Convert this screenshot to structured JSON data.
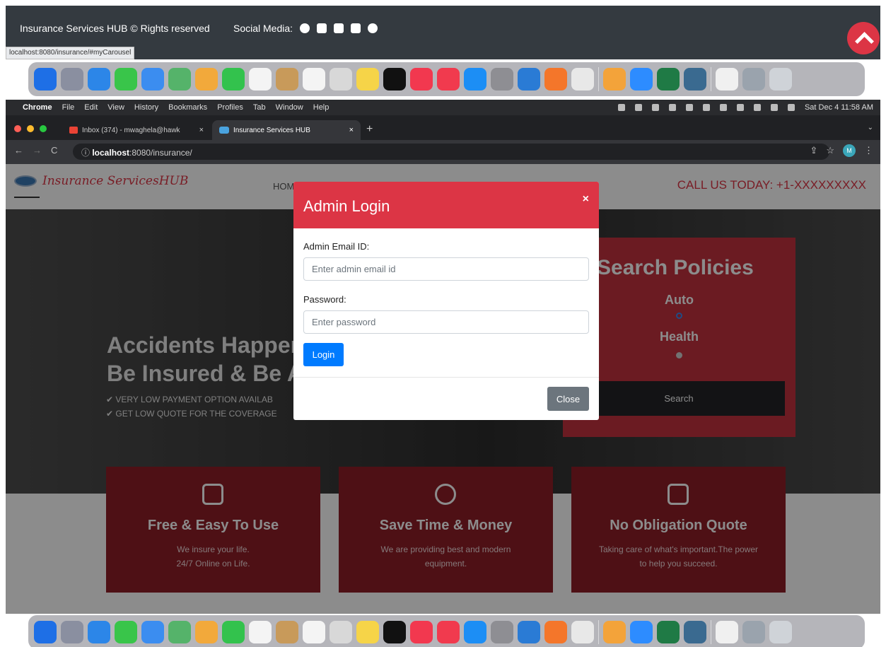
{
  "footer": {
    "copyright": "Insurance Services HUB © Rights reserved",
    "social_label": "Social Media:",
    "social_icons": [
      "facebook-icon",
      "instagram-icon",
      "linkedin-icon",
      "youtube-icon",
      "twitter-icon"
    ],
    "status_url": "localhost:8080/insurance/#myCarousel"
  },
  "dock_icons": [
    "finder",
    "launchpad",
    "safari",
    "messages",
    "mail",
    "maps",
    "photos",
    "facetime",
    "calendar",
    "contacts",
    "reminders",
    "screenshot",
    "notes",
    "apple-tv",
    "music",
    "news",
    "app-store",
    "system-preferences",
    "vscode",
    "firefox",
    "chrome",
    "sublime-text",
    "zoom",
    "excel",
    "mysql-workbench",
    "pdf-doc",
    "folder",
    "trash"
  ],
  "menubar": {
    "app": "Chrome",
    "items": [
      "File",
      "Edit",
      "View",
      "History",
      "Bookmarks",
      "Profiles",
      "Tab",
      "Window",
      "Help"
    ],
    "clock": "Sat Dec 4  11:58 AM"
  },
  "tabs": [
    {
      "title": "Inbox (374) - mwaghela@hawk",
      "close": "×"
    },
    {
      "title": "Insurance Services HUB",
      "close": "×"
    }
  ],
  "address": {
    "host": "localhost",
    "path": ":8080/insurance/",
    "profile_initial": "M"
  },
  "site": {
    "logo_text": "Insurance ServicesHUB",
    "nav_home": "HOME",
    "call_us": "CALL US TODAY: +1-XXXXXXXXX",
    "hero_line1": "Accidents Happen",
    "hero_line2": "Be Insured & Be A",
    "bullet1": "✔ VERY LOW PAYMENT OPTION AVAILAB",
    "bullet2": "✔ GET LOW QUOTE FOR THE COVERAGE",
    "search": {
      "title": "Search Policies",
      "option1": "Auto",
      "option2": "Health",
      "button": "Search"
    },
    "features": [
      {
        "icon": "thumbs-up-icon",
        "title": "Free & Easy To Use",
        "line1": "We insure your life.",
        "line2": "24/7 Online on Life."
      },
      {
        "icon": "clock-icon",
        "title": "Save Time & Money",
        "line1": "We are providing best and modern",
        "line2": "equipment."
      },
      {
        "icon": "document-icon",
        "title": "No Obligation Quote",
        "line1": "Taking care of what's important.The power",
        "line2": "to help you succeed."
      }
    ]
  },
  "modal": {
    "title": "Admin Login",
    "close_x": "×",
    "email_label": "Admin Email ID:",
    "email_placeholder": "Enter admin email id",
    "password_label": "Password:",
    "password_placeholder": "Enter password",
    "login_button": "Login",
    "close_button": "Close"
  },
  "colors": {
    "brand_red": "#dc3545",
    "primary_blue": "#007bff",
    "secondary_gray": "#6c757d"
  }
}
